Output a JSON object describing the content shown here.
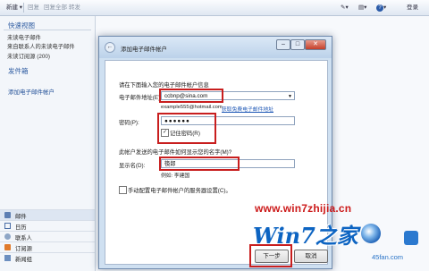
{
  "toolbar": {
    "new_label": "新建",
    "reply_label": "回复",
    "reply_all_label": "回复全部",
    "forward_label": "转发",
    "login_label": "登录"
  },
  "sidebar": {
    "quick_views_title": "快速视图",
    "quick_items": [
      "未读电子邮件",
      "来自联系人的未读电子邮件",
      "未读订阅源 (200)"
    ],
    "outbox_title": "发件箱",
    "add_account_link": "添加电子邮件帐户",
    "nav": [
      "邮件",
      "日历",
      "联系人",
      "订阅源",
      "新闻组"
    ]
  },
  "dialog": {
    "title": "添加电子邮件帐户",
    "intro": "请在下面输入您的电子邮件帐户信息",
    "email_label": "电子邮件地址(E):",
    "email_value": "ccbnp@sina.com",
    "email_example": "example555@hotmail.com",
    "free_account_link": "获取免费电子邮件地址",
    "password_label": "密码(P):",
    "password_value": "●●●●●●",
    "remember_label": "记住密码(R)",
    "display_question": "此帐户发送的电子邮件如何显示您的名字(M)?",
    "display_label": "显示名(D):",
    "display_value": "筷郎",
    "display_example": "例如: 李建国",
    "manual_config_label": "手动配置电子邮件帐户的服务器设置(C)。",
    "next_button": "下一步",
    "cancel_button": "取消"
  },
  "watermark": {
    "url": "www.win7zhijia.cn",
    "logo": "Win7之家",
    "sub": "45fan.com"
  },
  "colors": {
    "highlight_red": "#c81e1e",
    "link_blue": "#1c56b5",
    "watermark_red": "#cc1a1a",
    "watermark_blue": "#0d64c2"
  }
}
